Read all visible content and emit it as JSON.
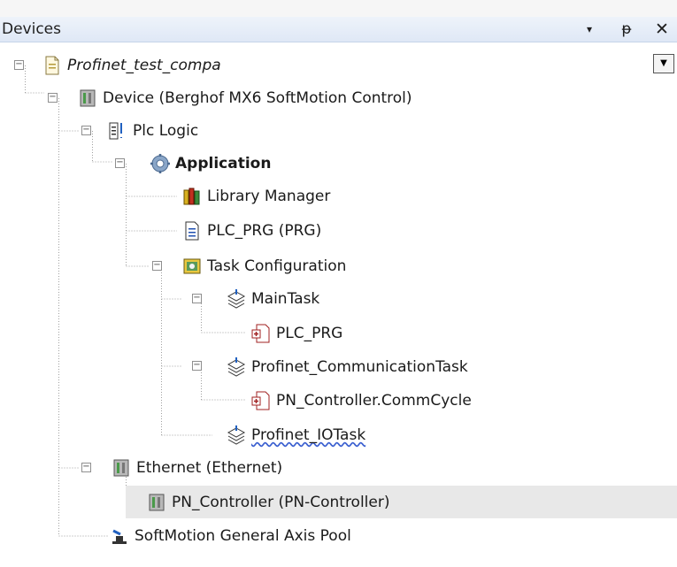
{
  "panel": {
    "title": "Devices",
    "dropdown_glyph": "▾",
    "pin_glyph": "ᵽ",
    "close_glyph": "✕",
    "scroll_dropdown_glyph": "▼"
  },
  "tree": [
    {
      "label": "Profinet_test_compa",
      "icon": "project-file-icon",
      "style": "italic"
    },
    {
      "label": "Device (Berghof MX6 SoftMotion Control)",
      "icon": "device-icon"
    },
    {
      "label": "Plc Logic",
      "icon": "plc-logic-icon"
    },
    {
      "label": "Application",
      "icon": "gear-icon",
      "style": "bold"
    },
    {
      "label": "Library Manager",
      "icon": "library-books-icon"
    },
    {
      "label": "PLC_PRG (PRG)",
      "icon": "program-file-icon"
    },
    {
      "label": "Task Configuration",
      "icon": "task-configuration-icon"
    },
    {
      "label": "MainTask",
      "icon": "task-stack-icon"
    },
    {
      "label": "PLC_PRG",
      "icon": "program-call-icon"
    },
    {
      "label": "Profinet_CommunicationTask",
      "icon": "task-stack-icon"
    },
    {
      "label": "PN_Controller.CommCycle",
      "icon": "program-call-icon"
    },
    {
      "label": "Profinet_IOTask",
      "icon": "task-stack-icon",
      "style": "squiggle"
    },
    {
      "label": "Ethernet (Ethernet)",
      "icon": "device-icon"
    },
    {
      "label": "PN_Controller (PN-Controller)",
      "icon": "device-icon",
      "selected": true
    },
    {
      "label": "SoftMotion General Axis Pool",
      "icon": "axis-pool-icon"
    }
  ],
  "expander_glyph": "−"
}
